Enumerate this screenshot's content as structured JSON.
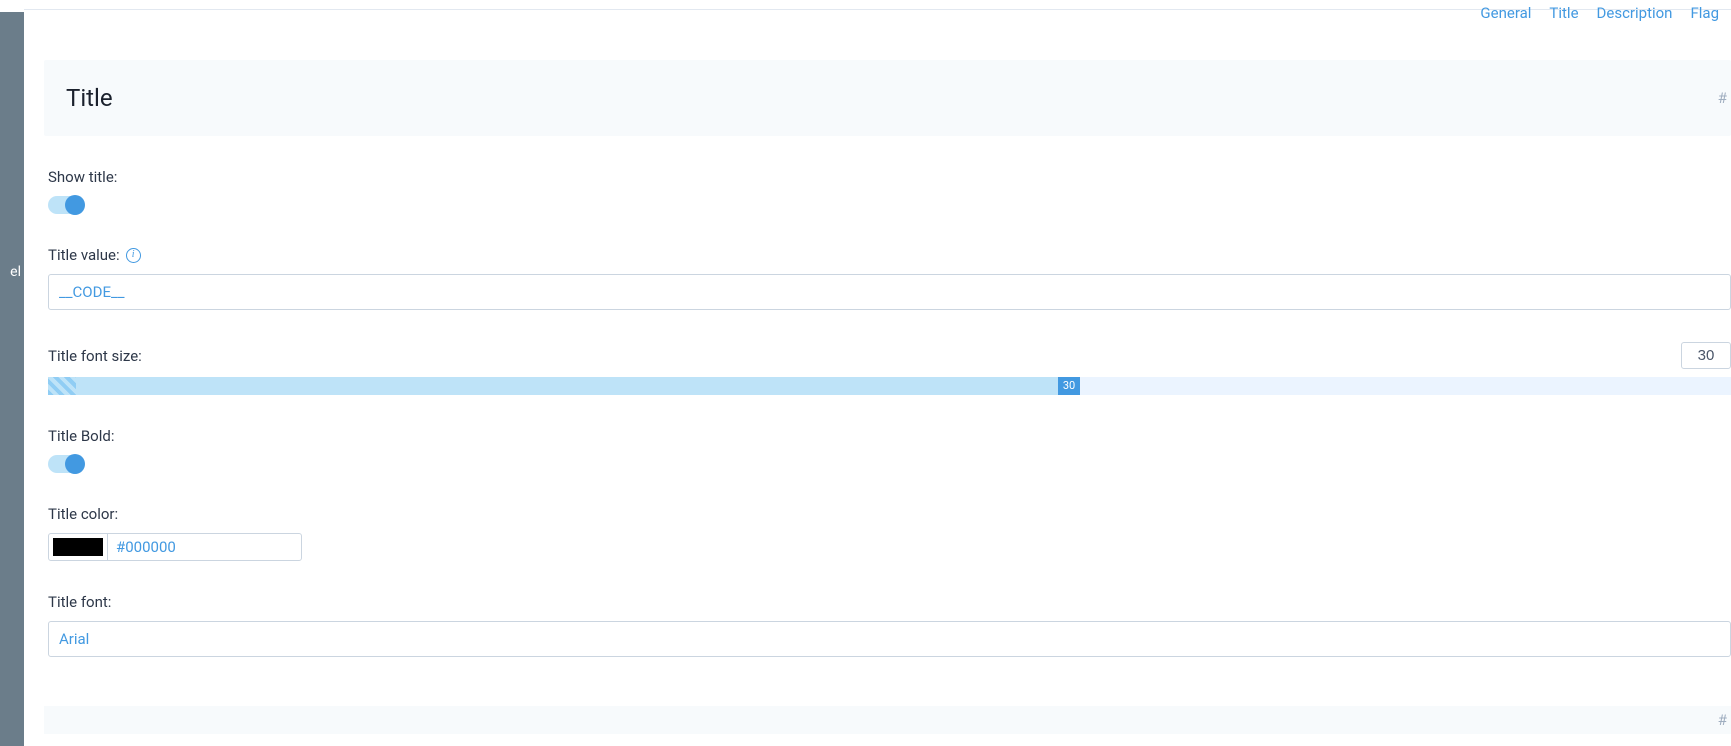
{
  "sidebar": {
    "fragment": "el"
  },
  "nav": {
    "general": "General",
    "title": "Title",
    "description": "Description",
    "flag": "Flag"
  },
  "section": {
    "heading": "Title",
    "anchor": "#"
  },
  "fields": {
    "show_title": {
      "label": "Show title:",
      "on": true
    },
    "title_value": {
      "label": "Title value:",
      "value": "__CODE__"
    },
    "title_font_size": {
      "label": "Title font size:",
      "value": 30,
      "min": 0,
      "max": 50
    },
    "title_bold": {
      "label": "Title Bold:",
      "on": true
    },
    "title_color": {
      "label": "Title color:",
      "hex": "#000000"
    },
    "title_font": {
      "label": "Title font:",
      "value": "Arial"
    }
  },
  "bottom_anchor": "#"
}
